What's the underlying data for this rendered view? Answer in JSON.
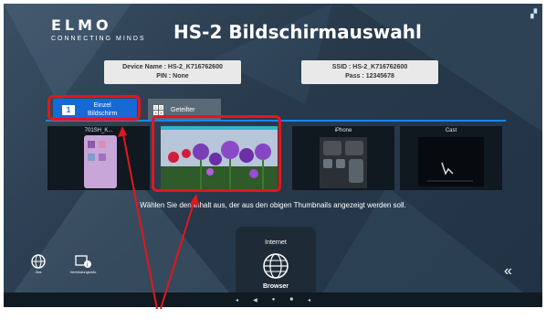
{
  "header": {
    "logo_main": "ELMO",
    "logo_sub": "CONNECTING MINDS",
    "title": "HS-2 Bildschirmauswahl"
  },
  "info": {
    "device_name": "Device Name : HS-2_K716762600",
    "pin": "PIN : None",
    "ssid": "SSID : HS-2_K716762600",
    "pass": "Pass : 12345678"
  },
  "tabs": [
    {
      "number": "1",
      "label_line1": "Einzel",
      "label_line2": "Bildschirm",
      "active": true
    },
    {
      "label_line1": "Geteilter",
      "label_line2": "",
      "active": false
    }
  ],
  "thumbnails": [
    {
      "label": "701SH_K...",
      "selected": false
    },
    {
      "label": "",
      "selected": true
    },
    {
      "label": "iPhone",
      "selected": false
    },
    {
      "label": "Cast",
      "selected": false
    }
  ],
  "instruction": "Wählen Sie den Inhalt aus, der aus den obigen Thumbnails angezeigt werden soll.",
  "browser_card": {
    "top_label": "Internet",
    "bottom_label": "Browser"
  },
  "side_buttons": [
    {
      "icon": "globe-icon",
      "label": "Jtzs"
    },
    {
      "icon": "connection-info-icon",
      "label": "Verbindungsinfo"
    }
  ],
  "collapse_glyph": "«",
  "colors": {
    "accent": "#1769d6",
    "annotation_red": "#e4161b",
    "background": "#2a3d50"
  }
}
